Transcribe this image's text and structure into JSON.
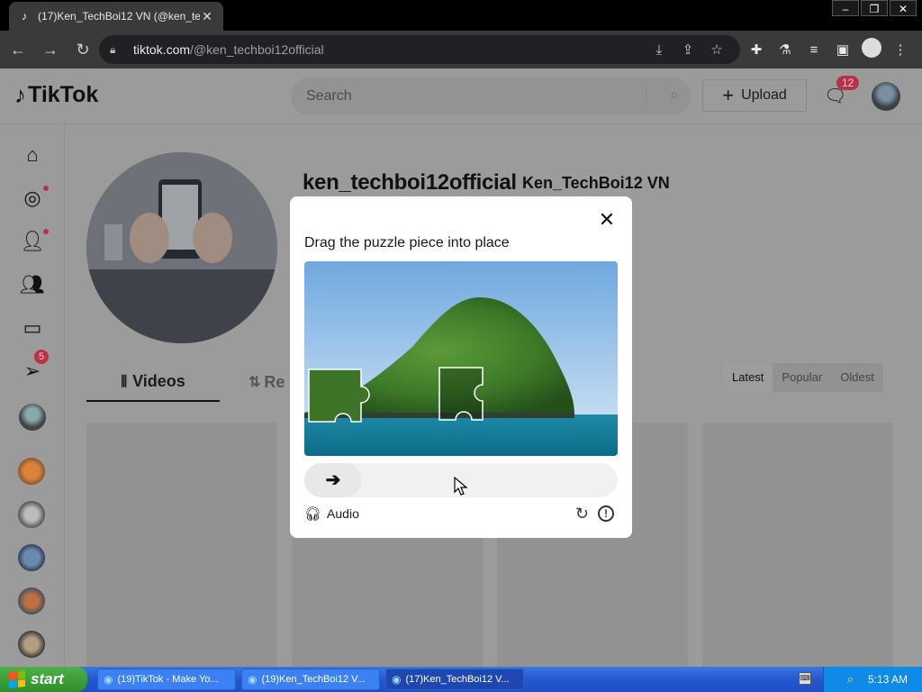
{
  "browser": {
    "tab_title": "(17)Ken_TechBoi12 VN (@ken_tech",
    "tab_icon": "tiktok-icon",
    "url_host": "tiktok.com",
    "url_path": "/@ken_techboi12official"
  },
  "tiktok": {
    "logo_text": "TikTok",
    "search_placeholder": "Search",
    "upload_label": "Upload",
    "inbox_badge": "12",
    "sidenav_badge": "5",
    "username": "ken_techboi12official",
    "display_name": "Ken_TechBoi12 VN",
    "tab_videos": "Videos",
    "tab_reposts": "Re",
    "sort_options": [
      "Latest",
      "Popular",
      "Oldest"
    ]
  },
  "captcha": {
    "prompt": "Drag the puzzle piece into place",
    "audio_label": "Audio",
    "slider_progress": 0.0
  },
  "taskbar": {
    "start_label": "start",
    "buttons": [
      "(19)TikTok - Make Yo...",
      "(19)Ken_TechBoi12 V...",
      "(17)Ken_TechBoi12 V..."
    ],
    "clock": "5:13 AM"
  },
  "colors": {
    "tiktok_red": "#fe2c55",
    "xp_blue": "#245edb",
    "xp_green": "#3c9d38"
  }
}
